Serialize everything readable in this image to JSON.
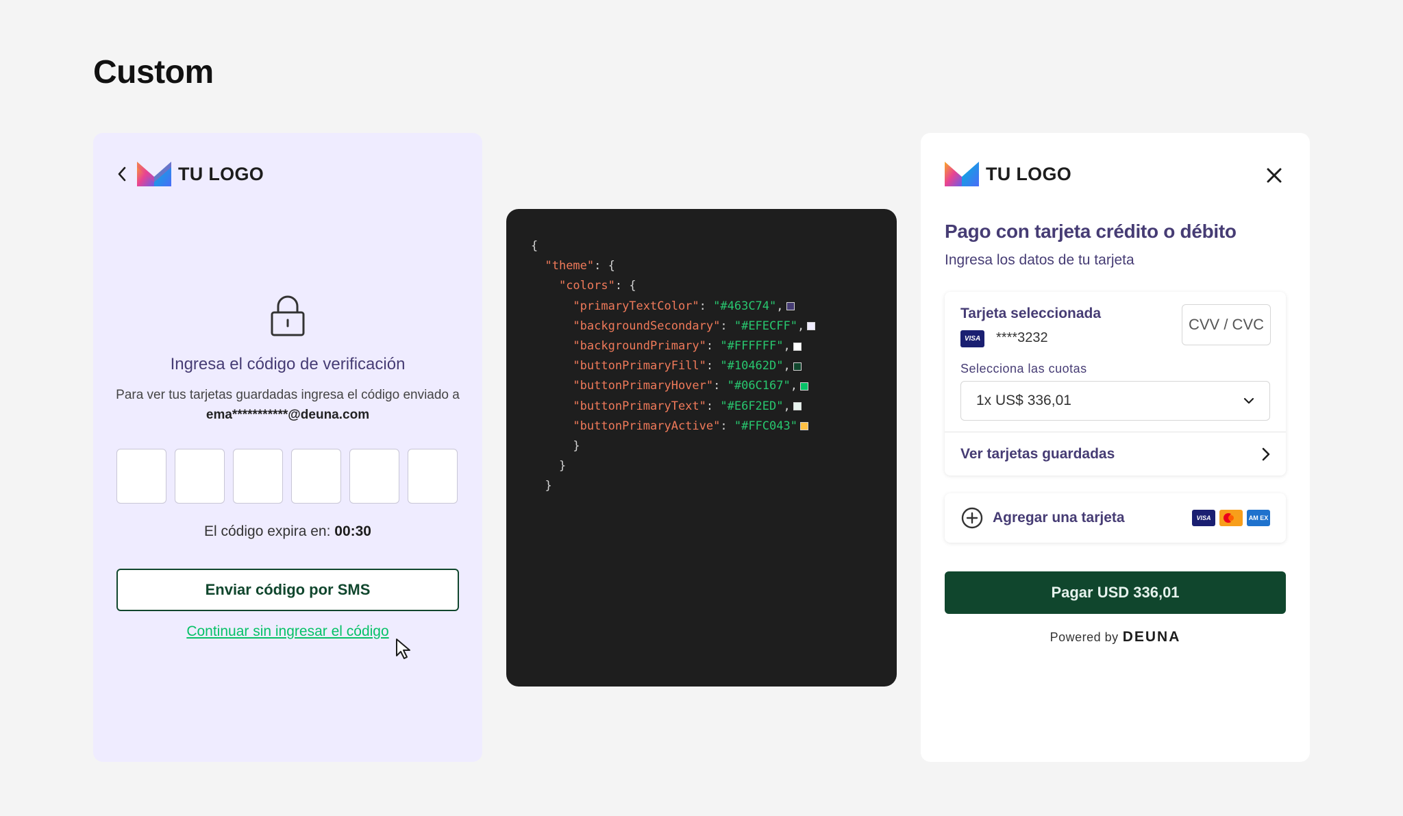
{
  "page": {
    "title": "Custom"
  },
  "left_panel": {
    "logo_text": "TU LOGO",
    "verify_title": "Ingresa el código de verificación",
    "verify_desc_prefix": "Para ver tus tarjetas guardadas ingresa el código enviado a ",
    "verify_email": "ema***********@deuna.com",
    "code_boxes": [
      "",
      "",
      "",
      "",
      "",
      ""
    ],
    "expire_label": "El código expira en: ",
    "expire_time": "00:30",
    "sms_button": "Enviar código por SMS",
    "continue_link": "Continuar sin ingresar el código"
  },
  "code_panel": {
    "lines": [
      {
        "indent": 0,
        "key": "",
        "value": "",
        "text": "{",
        "swatch": ""
      },
      {
        "indent": 1,
        "key": "\"theme\"",
        "value": "",
        "text": ": {",
        "swatch": ""
      },
      {
        "indent": 2,
        "key": "\"colors\"",
        "value": "",
        "text": ": {",
        "swatch": ""
      },
      {
        "indent": 3,
        "key": "\"primaryTextColor\"",
        "value": "\"#463C74\"",
        "text": ",",
        "swatch": "#463C74"
      },
      {
        "indent": 3,
        "key": "\"backgroundSecondary\"",
        "value": "\"#EFECFF\"",
        "text": ",",
        "swatch": "#EFECFF"
      },
      {
        "indent": 3,
        "key": "\"backgroundPrimary\"",
        "value": "\"#FFFFFF\"",
        "text": ",",
        "swatch": "#FFFFFF"
      },
      {
        "indent": 3,
        "key": "\"buttonPrimaryFill\"",
        "value": "\"#10462D\"",
        "text": ",",
        "swatch": "#10462D"
      },
      {
        "indent": 3,
        "key": "\"buttonPrimaryHover\"",
        "value": "\"#06C167\"",
        "text": ",",
        "swatch": "#06C167"
      },
      {
        "indent": 3,
        "key": "\"buttonPrimaryText\"",
        "value": "\"#E6F2ED\"",
        "text": ",",
        "swatch": "#E6F2ED"
      },
      {
        "indent": 3,
        "key": "\"buttonPrimaryActive\"",
        "value": "\"#FFC043\"",
        "text": "",
        "swatch": "#FFC043"
      },
      {
        "indent": 3,
        "key": "",
        "value": "",
        "text": "}",
        "swatch": ""
      },
      {
        "indent": 2,
        "key": "",
        "value": "",
        "text": "}",
        "swatch": ""
      },
      {
        "indent": 1,
        "key": "",
        "value": "",
        "text": "}",
        "swatch": ""
      }
    ]
  },
  "right_panel": {
    "logo_text": "TU LOGO",
    "title": "Pago con tarjeta crédito o débito",
    "subtitle": "Ingresa los datos de tu tarjeta",
    "selected_card_label": "Tarjeta seleccionada",
    "card_brand": "VISA",
    "card_number": "****3232",
    "cvv_placeholder": "CVV / CVC",
    "installments_label": "Selecciona las cuotas",
    "installments_value": "1x US$ 336,01",
    "saved_cards_label": "Ver tarjetas guardadas",
    "add_card_label": "Agregar una tarjeta",
    "brand_visa": "VISA",
    "brand_amex": "AM EX",
    "pay_button": "Pagar USD 336,01",
    "powered_by": "Powered by",
    "powered_brand": "DEUNA"
  },
  "colors": {
    "primary_text": "#463C74",
    "background_secondary": "#EFECFF",
    "background_primary": "#FFFFFF",
    "button_fill": "#10462D",
    "button_hover": "#06C167",
    "button_text": "#E6F2ED",
    "button_active": "#FFC043",
    "code_key": "#F07A5A",
    "code_value": "#28C76F"
  },
  "icons": {
    "back": "chevron-left-icon",
    "logo": "logo-mark-icon",
    "lock": "lock-icon",
    "cursor": "cursor-icon",
    "close": "close-icon",
    "dropdown": "chevron-down-icon",
    "saved_arrow": "chevron-right-icon",
    "add": "plus-circle-icon"
  }
}
